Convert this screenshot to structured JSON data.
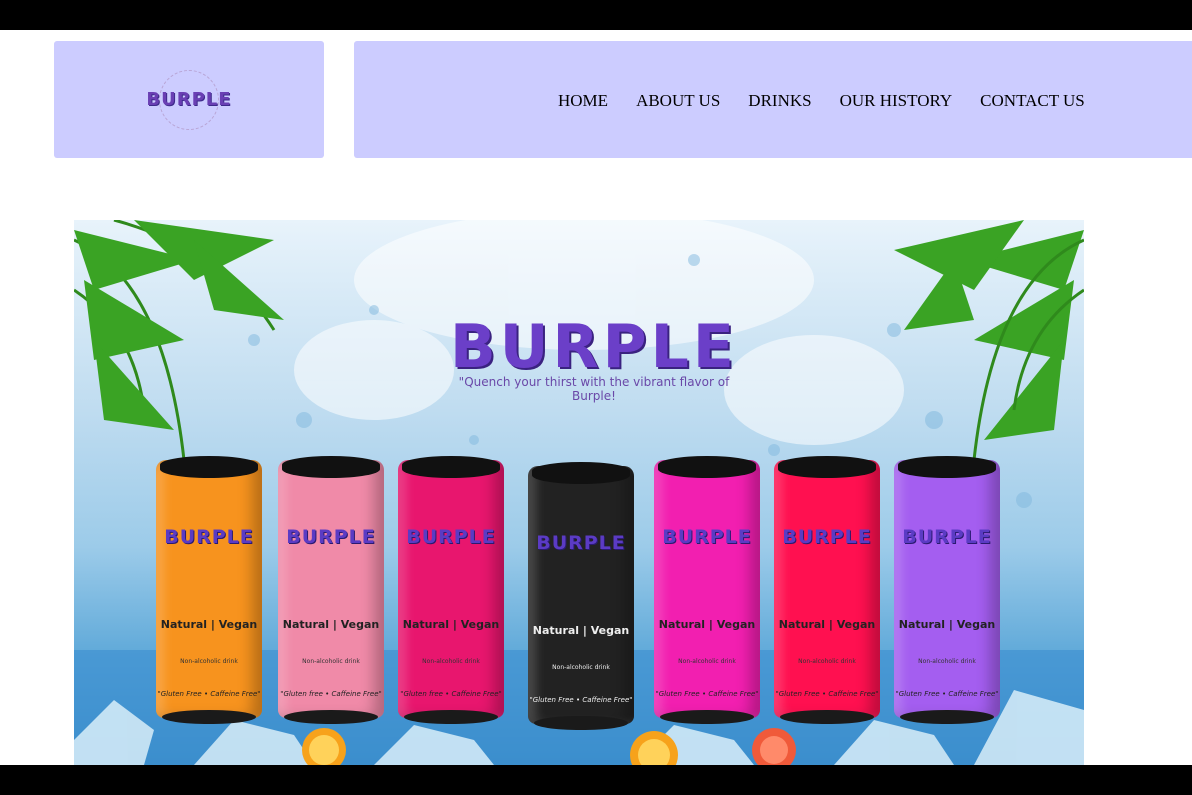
{
  "header": {
    "logo_text": "BURPLE"
  },
  "nav": {
    "items": [
      {
        "label": "HOME"
      },
      {
        "label": "ABOUT US"
      },
      {
        "label": "DRINKS"
      },
      {
        "label": "OUR HISTORY"
      },
      {
        "label": "CONTACT US"
      }
    ]
  },
  "hero": {
    "brand": "BURPLE",
    "tagline": "\"Quench your thirst with the vibrant flavor of Burple!",
    "cans": [
      {
        "color": "#f7931e",
        "brand": "BURPLE",
        "label": "Natural | Vegan",
        "sub": "Non-alcoholic drink",
        "footer": "\"Gluten Free • Caffeine Free\""
      },
      {
        "color": "#f08aa8",
        "brand": "BURPLE",
        "label": "Natural | Vegan",
        "sub": "Non-alcoholic drink",
        "footer": "\"Gluten free • Caffeine Free\""
      },
      {
        "color": "#e8166e",
        "brand": "BURPLE",
        "label": "Natural | Vegan",
        "sub": "Non-alcoholic drink",
        "footer": "\"Gluten free • Caffeine Free\""
      },
      {
        "color": "#222222",
        "brand": "BURPLE",
        "label": "Natural | Vegan",
        "sub": "Non-alcoholic drink",
        "footer": "\"Gluten Free • Caffeine Free\""
      },
      {
        "color": "#f21fb0",
        "brand": "BURPLE",
        "label": "Natural | Vegan",
        "sub": "Non-alcoholic drink",
        "footer": "\"Gluten Free • Caffeine Free\""
      },
      {
        "color": "#ff1050",
        "brand": "BURPLE",
        "label": "Natural | Vegan",
        "sub": "Non-alcoholic drink",
        "footer": "\"Gluten Free • Caffeine Free\""
      },
      {
        "color": "#a45ef0",
        "brand": "BURPLE",
        "label": "Natural | Vegan",
        "sub": "Non-alcoholic drink",
        "footer": "\"Gluten Free • Caffeine Free\""
      }
    ]
  }
}
